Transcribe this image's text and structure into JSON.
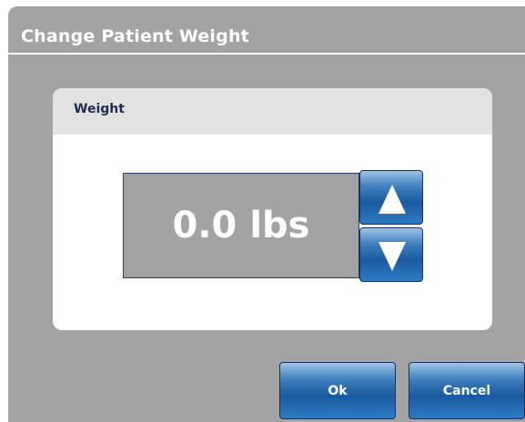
{
  "dialog": {
    "title": "Change Patient Weight"
  },
  "weight_panel": {
    "title": "Weight",
    "value": "0.0 lbs",
    "increment_icon": "triangle-up-icon",
    "decrement_icon": "triangle-down-icon"
  },
  "actions": {
    "ok_label": "Ok",
    "cancel_label": "Cancel"
  },
  "colors": {
    "dialog_background": "#a3a3a3",
    "panel_header": "#e2e2e2",
    "panel_title_text": "#1f2a4f",
    "button_blue": "#1a5aa0",
    "value_background": "#a3a3a3"
  }
}
